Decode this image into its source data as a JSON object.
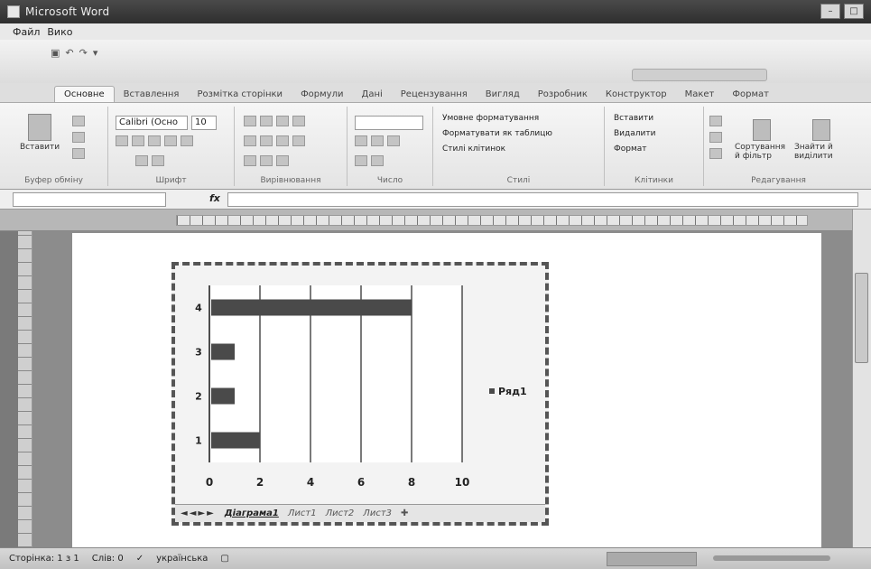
{
  "window": {
    "title": "Microsoft Word"
  },
  "menu": {
    "items": [
      "Файл",
      "Вико"
    ]
  },
  "tabs": [
    "Основне",
    "Вставлення",
    "Розмітка сторінки",
    "Формули",
    "Дані",
    "Рецензування",
    "Вигляд",
    "Розробник",
    "Конструктор",
    "Макет",
    "Формат"
  ],
  "ribbon": {
    "paste_label": "Вставити",
    "font_name": "Calibri (Осно",
    "font_size": "10",
    "groups": [
      "Буфер обміну",
      "Шрифт",
      "Вирівнювання",
      "Число",
      "Стилі",
      "Клітинки",
      "Редагування"
    ],
    "styles": [
      "Умовне форматування",
      "Форматувати як таблицю",
      "Стилі клітинок"
    ],
    "cells": [
      "Вставити",
      "Видалити",
      "Формат"
    ],
    "editing": [
      "Сортування й фільтр",
      "Знайти й виділити"
    ]
  },
  "formula": {
    "fx": "fx"
  },
  "chart_data": {
    "type": "bar",
    "orientation": "horizontal",
    "categories": [
      "1",
      "2",
      "3",
      "4"
    ],
    "series": [
      {
        "name": "Ряд1",
        "values": [
          2,
          1,
          1,
          8
        ],
        "color": "#4a4a4a"
      }
    ],
    "xlim": [
      0,
      10
    ],
    "xticks": [
      "0",
      "2",
      "4",
      "6",
      "8",
      "10"
    ],
    "grid": "vertical",
    "legend": "right"
  },
  "sheet_tabs": {
    "items": [
      "Діаграма1",
      "Лист1",
      "Лист2",
      "Лист3"
    ],
    "active": "Діаграма1"
  },
  "status": {
    "page": "Сторінка: 1 з 1",
    "words": "Слів: 0",
    "language": "українська"
  }
}
